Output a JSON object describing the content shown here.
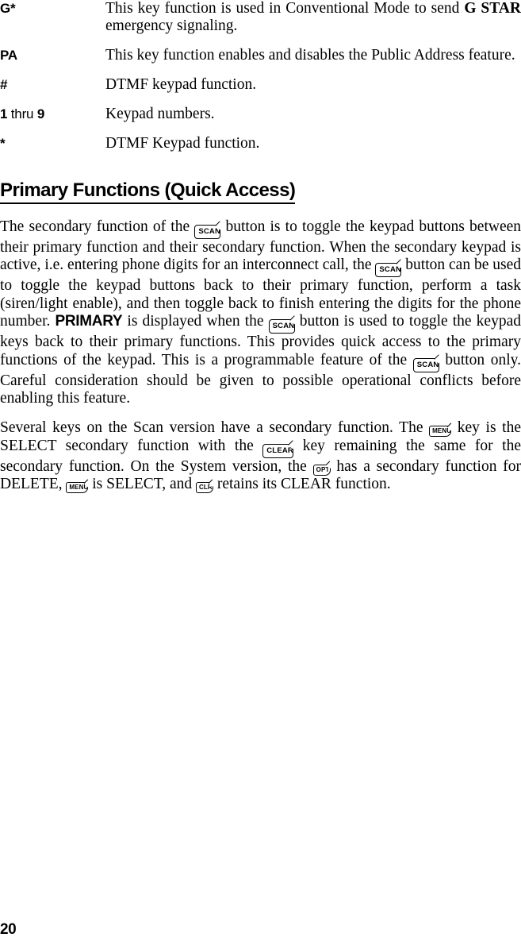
{
  "document": {
    "page_number": "20",
    "key_definitions": {
      "rows": [
        {
          "term": "G*",
          "term_suffix": "",
          "desc_pre": "This key function is used in Conventional Mode to send ",
          "desc_bold": "G STAR",
          "desc_post": " emergency signaling."
        },
        {
          "term": "PA",
          "term_suffix": "",
          "desc_pre": "This key function enables and disables the Public Address feature.",
          "desc_bold": "",
          "desc_post": ""
        },
        {
          "term": "#",
          "term_suffix": "",
          "desc_pre": "DTMF keypad function.",
          "desc_bold": "",
          "desc_post": ""
        },
        {
          "term": "1",
          "term_mid": " thru ",
          "term_suffix": "9",
          "desc_pre": "Keypad numbers.",
          "desc_bold": "",
          "desc_post": ""
        },
        {
          "term": "*",
          "term_suffix": "",
          "desc_pre": "DTMF Keypad function.",
          "desc_bold": "",
          "desc_post": ""
        }
      ]
    },
    "section": {
      "heading": "Primary Functions (Quick Access)",
      "paragraph_1": {
        "seg_1": "The secondary function of the ",
        "key_1": "SCAN",
        "seg_2": " button is to toggle the keypad buttons between their primary function and their secondary function. When the secondary keypad is active, i.e. entering phone digits for an interconnect call, the ",
        "key_2": "SCAN",
        "seg_3": " button can be used to toggle the keypad buttons back to their primary function, perform a task (siren/light enable), and then toggle back to finish entering the digits for the phone number.  ",
        "emphasis": "PRIMARY",
        "seg_4": " is displayed when the ",
        "key_3": "SCAN",
        "seg_5": " button is used to toggle the keypad keys back to their primary functions. This provides quick access to the primary functions of the keypad.  This is a programmable feature of the ",
        "key_4": "SCAN",
        "seg_6": " button only. Careful consideration should be given to possible operational conflicts before enabling this feature."
      },
      "paragraph_2": {
        "seg_1": "Several keys on the Scan version have a secondary function.  The ",
        "key_1": "MENU",
        "seg_2": " key is the SELECT secondary function with the ",
        "key_2": "CLEAR",
        "seg_3": "  key remaining the same for the secondary function.  On the System version, the ",
        "key_3": "OPT",
        "seg_4": " has a secondary function for DELETE, ",
        "key_4": "MENU",
        "seg_5": " is SELECT, and ",
        "key_5": "CLR",
        "seg_6": " retains its CLEAR function."
      }
    }
  }
}
